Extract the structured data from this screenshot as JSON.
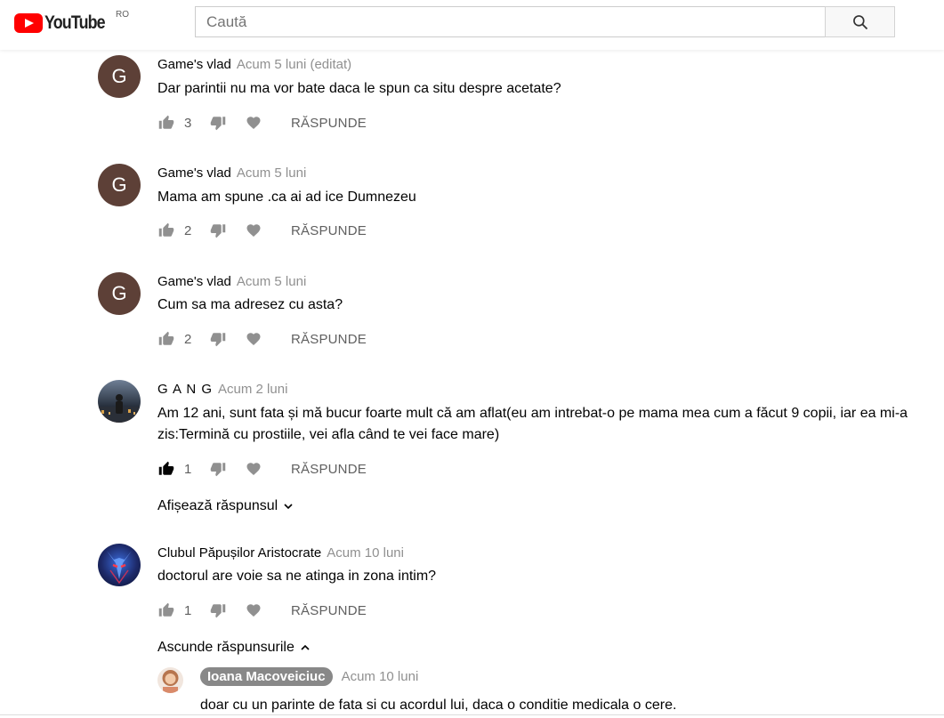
{
  "header": {
    "logo_text": "YouTube",
    "country_code": "RO",
    "search_placeholder": "Caută"
  },
  "comments": [
    {
      "avatar_letter": "G",
      "author": "Game's vlad",
      "time": "Acum 5 luni (editat)",
      "text": "Dar parintii nu ma vor bate daca le spun ca situ despre acetate?",
      "likes": "3",
      "reply_label": "RĂSPUNDE"
    },
    {
      "avatar_letter": "G",
      "author": "Game's vlad",
      "time": "Acum 5 luni",
      "text": "Mama am spune .ca ai ad ice Dumnezeu",
      "likes": "2",
      "reply_label": "RĂSPUNDE"
    },
    {
      "avatar_letter": "G",
      "author": "Game's vlad",
      "time": "Acum 5 luni",
      "text": "Cum sa ma adresez cu asta?",
      "likes": "2",
      "reply_label": "RĂSPUNDE"
    },
    {
      "avatar_letter": "",
      "author": "G A N G",
      "time": "Acum 2 luni",
      "text_line1": "Am 12 ani, sunt fata și mă bucur foarte mult că am aflat(eu am intrebat-o pe mama mea cum a făcut 9 copii, iar ea mi-a",
      "text_line2": "zis:Termină cu prostiile, vei afla când te vei face mare)",
      "likes": "1",
      "reply_label": "RĂSPUNDE",
      "toggle_label": "Afișează răspunsul"
    },
    {
      "avatar_letter": "",
      "author": "Clubul Păpușilor Aristocrate",
      "time": "Acum 10 luni",
      "text": "doctorul are voie sa ne atinga in zona intim?",
      "likes": "1",
      "reply_label": "RĂSPUNDE",
      "toggle_label": "Ascunde răspunsurile"
    }
  ],
  "reply": {
    "author": "Ioana Macoveiciuc",
    "time": "Acum 10 luni",
    "text": "doar cu un parinte de fata si cu acordul lui, daca o conditie medicala o cere."
  },
  "colors": {
    "brand_red": "#ff0000",
    "avatar_brown": "#5d4037",
    "muted_text": "#909090",
    "action_gray": "#909090"
  }
}
